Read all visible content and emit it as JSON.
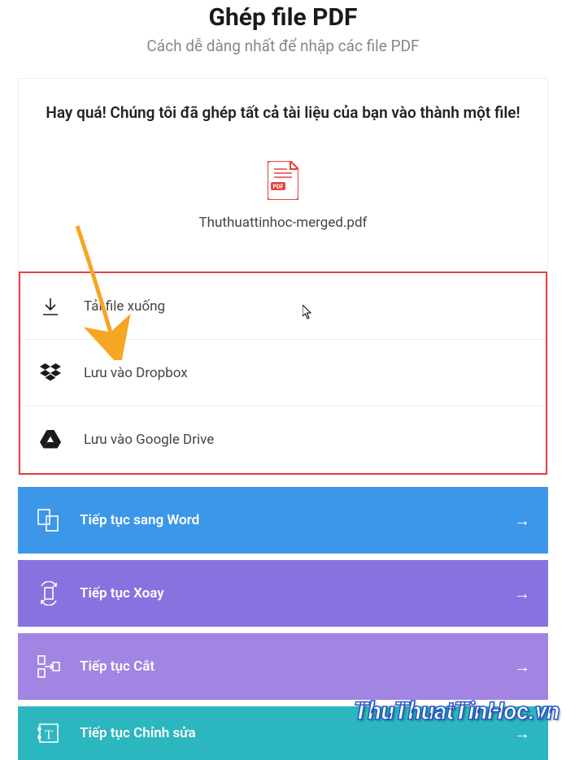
{
  "header": {
    "title": "Ghép file PDF",
    "subtitle": "Cách dễ dàng nhất để nhập các file PDF"
  },
  "result": {
    "success_message": "Hay quá! Chúng tôi đã ghép tất cả tài liệu của bạn vào thành một file!",
    "file_name": "Thuthuattinhoc-merged.pdf"
  },
  "actions": {
    "download": "Tải file xuống",
    "dropbox": "Lưu vào Dropbox",
    "gdrive": "Lưu vào Google Drive"
  },
  "next": {
    "word": "Tiếp tục sang Word",
    "rotate": "Tiếp tục Xoay",
    "split": "Tiếp tục Cắt",
    "edit": "Tiếp tục Chỉnh sửa"
  },
  "watermark": "ThuThuatTinHoc.vn"
}
